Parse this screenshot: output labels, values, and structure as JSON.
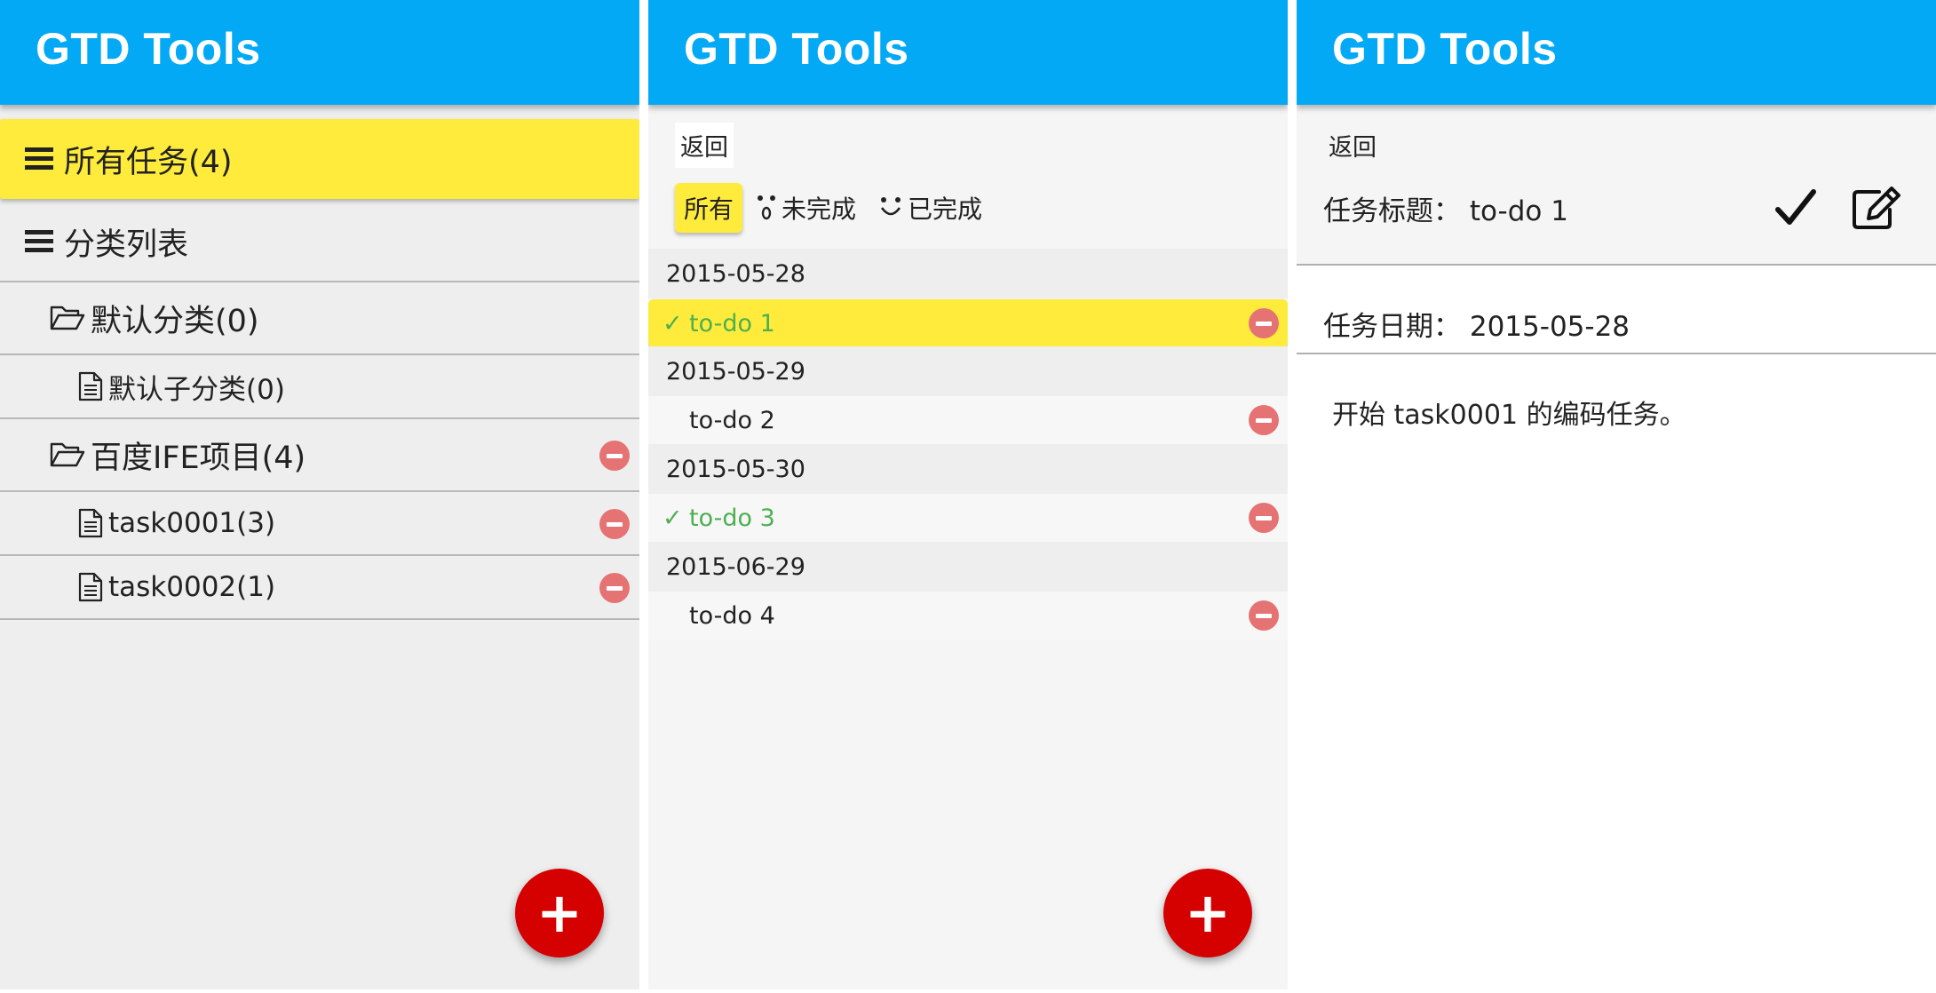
{
  "app": {
    "title": "GTD Tools"
  },
  "panel1": {
    "all_tasks": "所有任务(4)",
    "category_list": "分类列表",
    "items": [
      {
        "label": "默认分类(0)"
      },
      {
        "label": "默认子分类(0)"
      },
      {
        "label": "百度IFE项目(4)"
      },
      {
        "label": "task0001(3)"
      },
      {
        "label": "task0002(1)"
      }
    ],
    "fab": "+"
  },
  "panel2": {
    "back": "返回",
    "filters": {
      "all": "所有",
      "incomplete": "未完成",
      "complete": "已完成"
    },
    "groups": [
      {
        "date": "2015-05-28",
        "tasks": [
          {
            "name": "to-do 1",
            "done": true,
            "selected": true
          }
        ]
      },
      {
        "date": "2015-05-29",
        "tasks": [
          {
            "name": "to-do 2",
            "done": false
          }
        ]
      },
      {
        "date": "2015-05-30",
        "tasks": [
          {
            "name": "to-do 3",
            "done": true
          }
        ]
      },
      {
        "date": "2015-06-29",
        "tasks": [
          {
            "name": "to-do 4",
            "done": false
          }
        ]
      }
    ],
    "check_mark": "✓",
    "fab": "+"
  },
  "panel3": {
    "back": "返回",
    "title_label": "任务标题：",
    "title_value": "to-do 1",
    "date_label": "任务日期：",
    "date_value": "2015-05-28",
    "description": "开始 task0001 的编码任务。"
  },
  "colors": {
    "appbar": "#03a9f4",
    "highlight": "#ffeb3b",
    "fab": "#d50000",
    "done": "#4caf50",
    "delete": "#e57373"
  }
}
